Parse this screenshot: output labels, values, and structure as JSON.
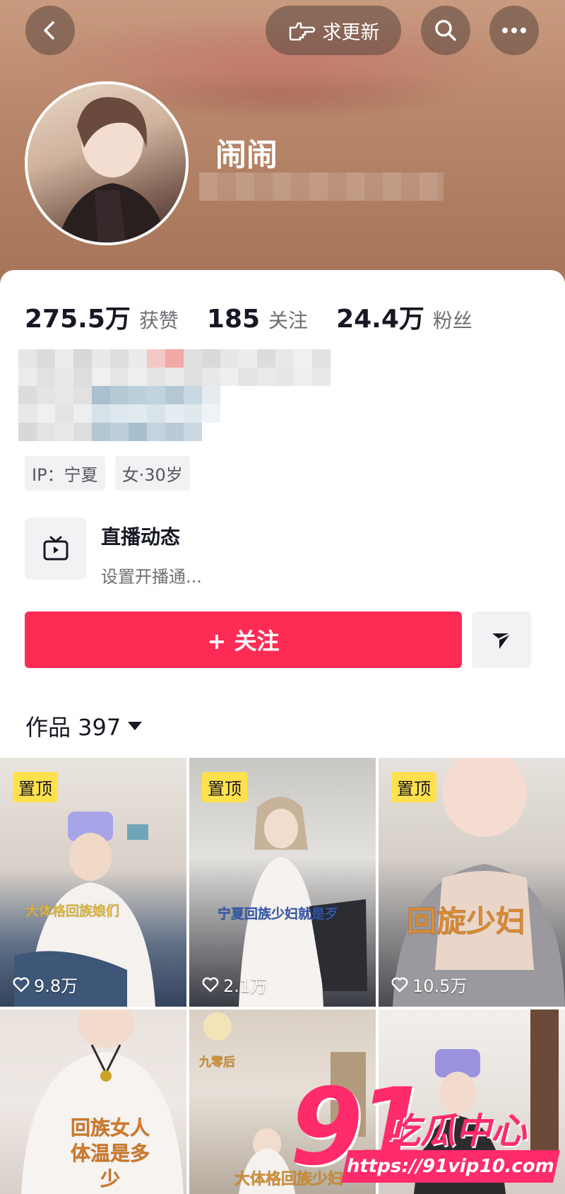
{
  "header": {
    "update_label": "求更新",
    "username": "闹闹"
  },
  "stats": [
    {
      "value": "275.5万",
      "label": "获赞"
    },
    {
      "value": "185",
      "label": "关注"
    },
    {
      "value": "24.4万",
      "label": "粉丝"
    }
  ],
  "tags": [
    "IP：宁夏",
    "女·30岁"
  ],
  "live": {
    "title": "直播动态",
    "subtitle": "设置开播通..."
  },
  "follow_label": "+ 关注",
  "works": {
    "label": "作品 397"
  },
  "videos": [
    {
      "pinned": "置顶",
      "likes": "9.8万",
      "caption": "大体格回族娘们"
    },
    {
      "pinned": "置顶",
      "likes": "2.1万",
      "caption": "宁夏回族少妇就是歹"
    },
    {
      "pinned": "置顶",
      "likes": "10.5万",
      "caption": "回旋少妇"
    },
    {
      "pinned": "",
      "likes": "",
      "caption": "回族女人\n体温是多\n少"
    },
    {
      "pinned": "",
      "likes": "",
      "caption_top": "九零后",
      "caption": "大体格回族少妇"
    },
    {
      "pinned": "",
      "likes": "",
      "caption": ""
    }
  ],
  "watermark": {
    "big": "91",
    "cn": "吃瓜中心",
    "url": "https://91vip10.com"
  },
  "colors": {
    "accent": "#fe2c55",
    "pin": "#ffe14d",
    "watermark": "#ff2b6a"
  }
}
